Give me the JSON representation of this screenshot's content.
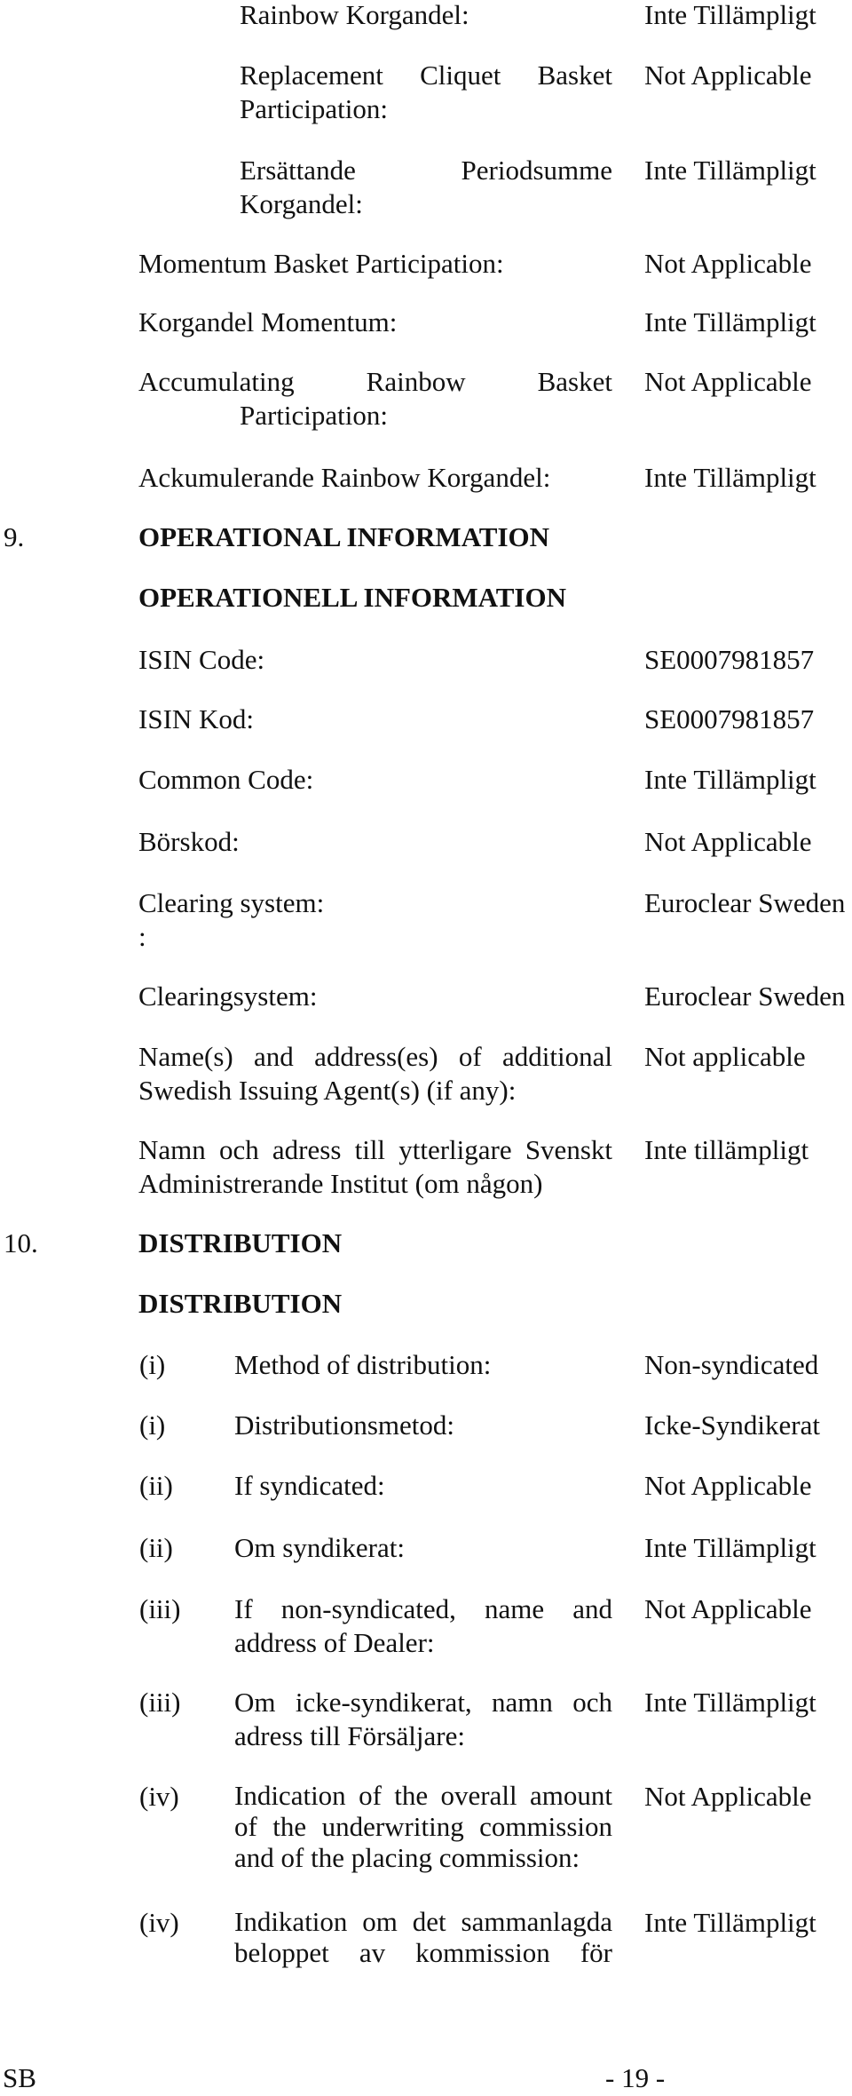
{
  "top_rows": [
    {
      "label": "Rainbow Korgandel:",
      "value": "Inte Tillämpligt"
    },
    {
      "label": "Replacement Cliquet Basket Participation:",
      "value": "Not Applicable"
    },
    {
      "label": "Ersättande Periodsumme Korgandel:",
      "value": "Inte Tillämpligt"
    },
    {
      "label": "Momentum Basket Participation:",
      "value": "Not Applicable"
    },
    {
      "label": "Korgandel Momentum:",
      "value": "Inte Tillämpligt"
    },
    {
      "label": "Accumulating Rainbow Basket Participation:",
      "value": "Not Applicable"
    },
    {
      "label": "Ackumulerande Rainbow Korgandel:",
      "value": "Inte Tillämpligt"
    }
  ],
  "section9": {
    "number": "9.",
    "title": "OPERATIONAL INFORMATION",
    "title_sv": "OPERATIONELL INFORMATION",
    "rows": [
      {
        "label": "ISIN Code:",
        "value": "SE0007981857"
      },
      {
        "label": "ISIN Kod:",
        "value": "SE0007981857"
      },
      {
        "label": "Common Code:",
        "value": "Inte Tillämpligt"
      },
      {
        "label": "Börskod:",
        "value": "Not Applicable"
      },
      {
        "label": "Clearing system:",
        "extra": ":",
        "value": "Euroclear Sweden"
      },
      {
        "label": "Clearingsystem:",
        "value": "Euroclear Sweden"
      },
      {
        "label": "Name(s) and address(es) of additional Swedish Issuing Agent(s) (if any):",
        "value": "Not applicable"
      },
      {
        "label": "Namn och adress till ytterligare Svenskt Administrerande Institut (om någon)",
        "value": "Inte tillämpligt"
      }
    ]
  },
  "section10": {
    "number": "10.",
    "title": "DISTRIBUTION",
    "title_sv": "DISTRIBUTION",
    "rows": [
      {
        "num": "(i)",
        "label": "Method of distribution:",
        "value": "Non-syndicated"
      },
      {
        "num": "(i)",
        "label": "Distributionsmetod:",
        "value": "Icke-Syndikerat"
      },
      {
        "num": "(ii)",
        "label": "If syndicated:",
        "value": "Not Applicable"
      },
      {
        "num": "(ii)",
        "label": "Om syndikerat:",
        "value": "Inte Tillämpligt"
      },
      {
        "num": "(iii)",
        "label": "If non-syndicated, name and address of Dealer:",
        "value": "Not Applicable"
      },
      {
        "num": "(iii)",
        "label": "Om icke-syndikerat, namn och adress till Försäljare:",
        "value": "Inte Tillämpligt"
      },
      {
        "num": "(iv)",
        "label": "Indication of the overall amount of the underwriting commission and of the placing commission:",
        "value": "Not Applicable"
      },
      {
        "num": "(iv)",
        "label": "Indikation om det sammanlagda beloppet av kommission för",
        "value": "Inte Tillämpligt"
      }
    ]
  },
  "footer": {
    "left": "SB",
    "page": "- 19 -"
  }
}
